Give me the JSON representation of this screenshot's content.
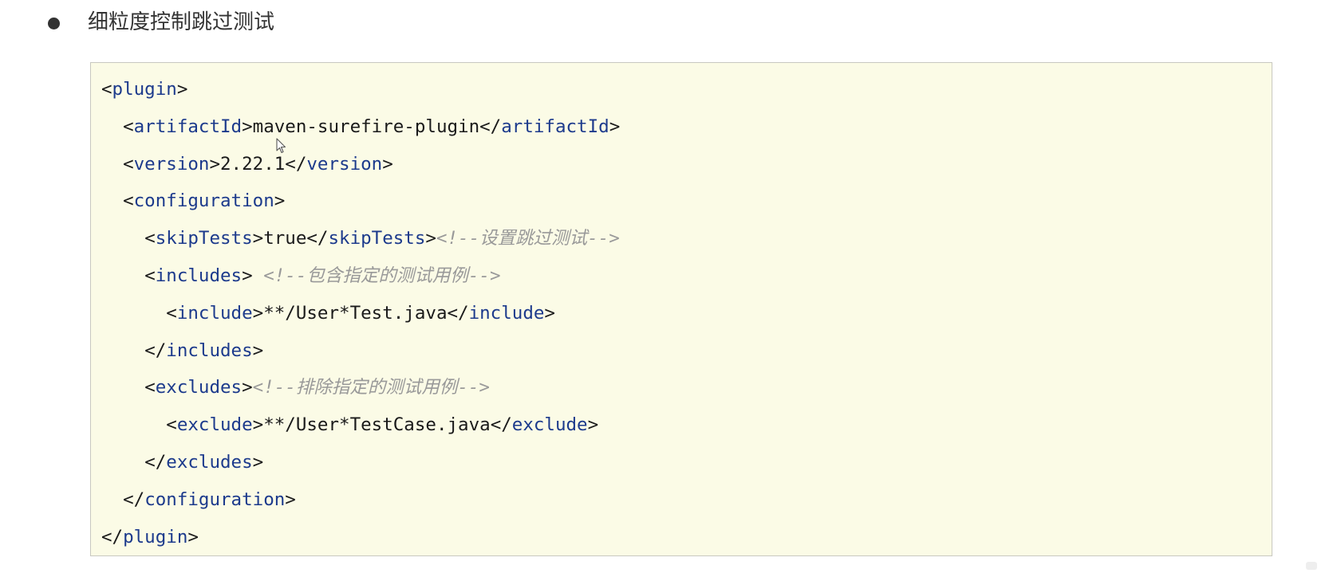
{
  "section": {
    "bullet_icon": "bullet-dot",
    "title": "细粒度控制跳过测试"
  },
  "code_block": {
    "lines": [
      {
        "indent": 0,
        "open": "plugin",
        "text": "",
        "close": "",
        "sep": "",
        "comment": ""
      },
      {
        "indent": 1,
        "open": "artifactId",
        "text": "maven-surefire-plugin",
        "close": "artifactId",
        "sep": "",
        "comment": ""
      },
      {
        "indent": 1,
        "open": "version",
        "text": "2.22.1",
        "close": "version",
        "sep": "",
        "comment": ""
      },
      {
        "indent": 1,
        "open": "configuration",
        "text": "",
        "close": "",
        "sep": "",
        "comment": ""
      },
      {
        "indent": 2,
        "open": "skipTests",
        "text": "true",
        "close": "skipTests",
        "sep": "",
        "comment": "<!--设置跳过测试-->"
      },
      {
        "indent": 2,
        "open": "includes",
        "text": "",
        "close": "",
        "sep": " ",
        "comment": "<!--包含指定的测试用例-->"
      },
      {
        "indent": 3,
        "open": "include",
        "text": "**/User*Test.java",
        "close": "include",
        "sep": "",
        "comment": ""
      },
      {
        "indent": 2,
        "open": "",
        "text": "",
        "close": "includes",
        "sep": "",
        "comment": ""
      },
      {
        "indent": 2,
        "open": "excludes",
        "text": "",
        "close": "",
        "sep": "",
        "comment": "<!--排除指定的测试用例-->"
      },
      {
        "indent": 3,
        "open": "exclude",
        "text": "**/User*TestCase.java",
        "close": "exclude",
        "sep": "",
        "comment": ""
      },
      {
        "indent": 2,
        "open": "",
        "text": "",
        "close": "excludes",
        "sep": "",
        "comment": ""
      },
      {
        "indent": 1,
        "open": "",
        "text": "",
        "close": "configuration",
        "sep": "",
        "comment": ""
      },
      {
        "indent": 0,
        "open": "",
        "text": "",
        "close": "plugin",
        "sep": "",
        "comment": ""
      }
    ]
  },
  "colors": {
    "tag_name": "#1c3a8c",
    "punctuation": "#1a1a1a",
    "comment": "#999999",
    "code_background": "#fbfbe6",
    "code_border": "#c8c8c0"
  },
  "icons": {
    "mouse_cursor": "cursor-arrow-icon"
  }
}
